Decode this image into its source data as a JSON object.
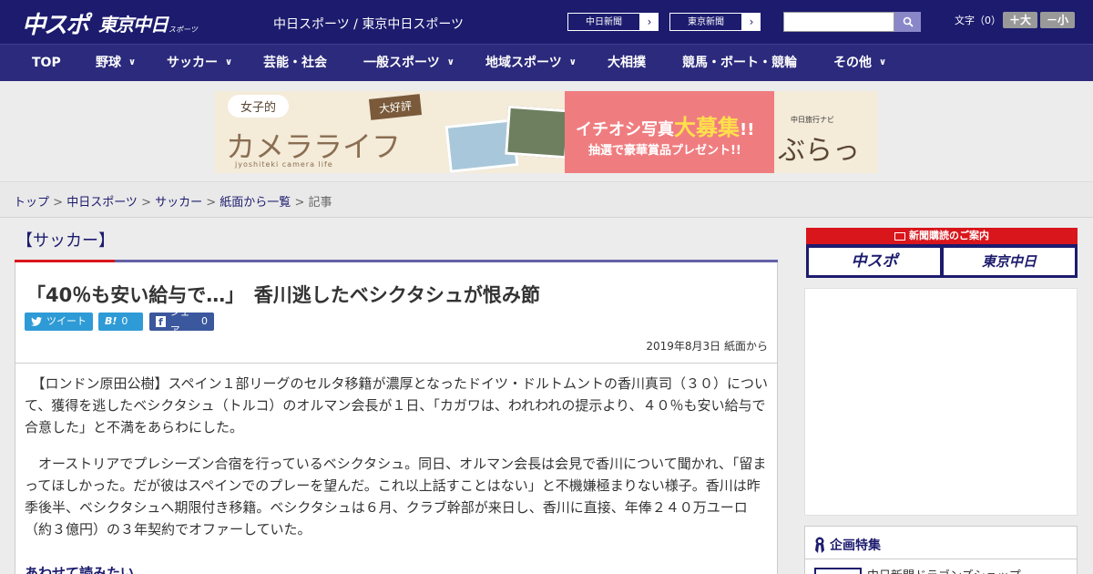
{
  "header": {
    "logo": "中スポ",
    "logo_tokyo": "東京中日",
    "logo_tokyo_small": "スポーツ",
    "site_name": "中日スポーツ / 東京中日スポーツ",
    "link_chunichi": "中日新聞",
    "link_tokyo": "東京新聞",
    "search_placeholder": "",
    "font_label": "文字（0）",
    "font_up": "＋大",
    "font_down": "－小"
  },
  "nav": {
    "items": [
      {
        "label": "TOP",
        "has_menu": false
      },
      {
        "label": "野球",
        "has_menu": true
      },
      {
        "label": "サッカー",
        "has_menu": true
      },
      {
        "label": "芸能・社会",
        "has_menu": false
      },
      {
        "label": "一般スポーツ",
        "has_menu": true
      },
      {
        "label": "地域スポーツ",
        "has_menu": true
      },
      {
        "label": "大相撲",
        "has_menu": false
      },
      {
        "label": "競馬・ボート・競輪",
        "has_menu": false
      },
      {
        "label": "その他",
        "has_menu": true
      }
    ]
  },
  "banner": {
    "joshi": "女子的",
    "kamera": "カメラライフ",
    "tag": "大好評",
    "sub": "jyoshiteki camera life",
    "bosyu_pre": "イチオシ写真",
    "bosyu_big": "大募集",
    "bosyu_post": "!!",
    "prize": "抽選で豪華賞品プレゼント!!",
    "brand_small": "中日旅行ナビ",
    "brand": "ぶらっ人"
  },
  "breadcrumb": {
    "items": [
      "トップ",
      "中日スポーツ",
      "サッカー",
      "紙面から一覧"
    ],
    "current": "記事",
    "sep": " > "
  },
  "article": {
    "category": "【サッカー】",
    "headline": "「40％も安い給与で…」　香川逃したベシクタシュが恨み節",
    "tweet_label": "ツイート",
    "hatena_label": "B!",
    "hatena_count": "0",
    "share_label": "シェア",
    "share_count": "0",
    "date": "2019年8月3日 紙面から",
    "paragraphs": [
      "　【ロンドン原田公樹】スペイン１部リーグのセルタ移籍が濃厚となったドイツ・ドルトムントの香川真司（３０）について、獲得を逃したベシクタシュ（トルコ）のオルマン会長が１日、「カガワは、われわれの提示より、４０％も安い給与で合意した」と不満をあらわにした。",
      "　オーストリアでプレシーズン合宿を行っているベシクタシュ。同日、オルマン会長は会見で香川について聞かれ、「留まってほしかった。だが彼はスペインでのプレーを望んだ。これ以上話すことはない」と不機嫌極まりない様子。香川は昨季後半、ベシクタシュへ期限付き移籍。ベシクタシュは６月、クラブ幹部が来日し、香川に直接、年俸２４０万ユーロ（約３億円）の３年契約でオファーしていた。"
    ],
    "see_also": "あわせて読みたい"
  },
  "sidebar": {
    "subscribe_head": "新聞購読のご案内",
    "subscribe_chuspo": "中スポ",
    "subscribe_tokyo": "東京中日",
    "feature_head": "企画特集",
    "feature_item": "中日新聞ドラゴンズショップ"
  },
  "colors": {
    "header_bg": "#1c1b6e",
    "nav_bg": "#2b2a7c",
    "accent_red": "#d9161c",
    "accent_blue": "#6461a6",
    "twitter": "#2e9bd6"
  }
}
